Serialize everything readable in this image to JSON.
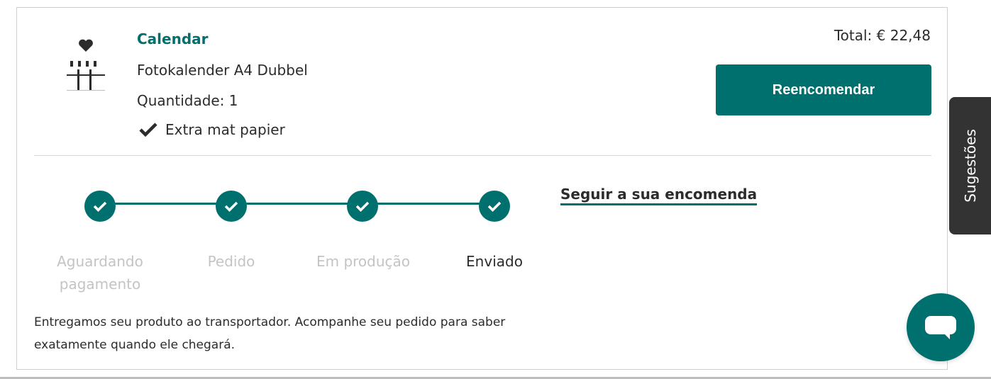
{
  "order_item": {
    "category": "Calendar",
    "product_name": "Fotokalender A4 Dubbel",
    "quantity": "Quantidade: 1",
    "option": "Extra mat papier",
    "total": "Total: € 22,48",
    "reorder_label": "Reencomendar"
  },
  "tracking": {
    "steps": [
      {
        "label": "Aguardando pagamento",
        "state": "complete"
      },
      {
        "label": "Pedido",
        "state": "complete"
      },
      {
        "label": "Em produção",
        "state": "complete"
      },
      {
        "label": "Enviado",
        "state": "current"
      }
    ],
    "track_link": "Seguir a sua encomenda",
    "message": "Entregamos seu produto ao transportador. Acompanhe seu pedido para saber exatamente quando ele chegará."
  },
  "feedback_tab": {
    "label": "Sugestões"
  },
  "chat": {
    "icon": "chat-bubble-icon"
  },
  "colors": {
    "accent": "#00706f",
    "text": "#2c2c2c",
    "muted": "#c4c4c4",
    "tab": "#333333"
  },
  "icons": {
    "product": "calendar-product-icon",
    "option_check": "check-icon",
    "step_check": "check-icon"
  }
}
